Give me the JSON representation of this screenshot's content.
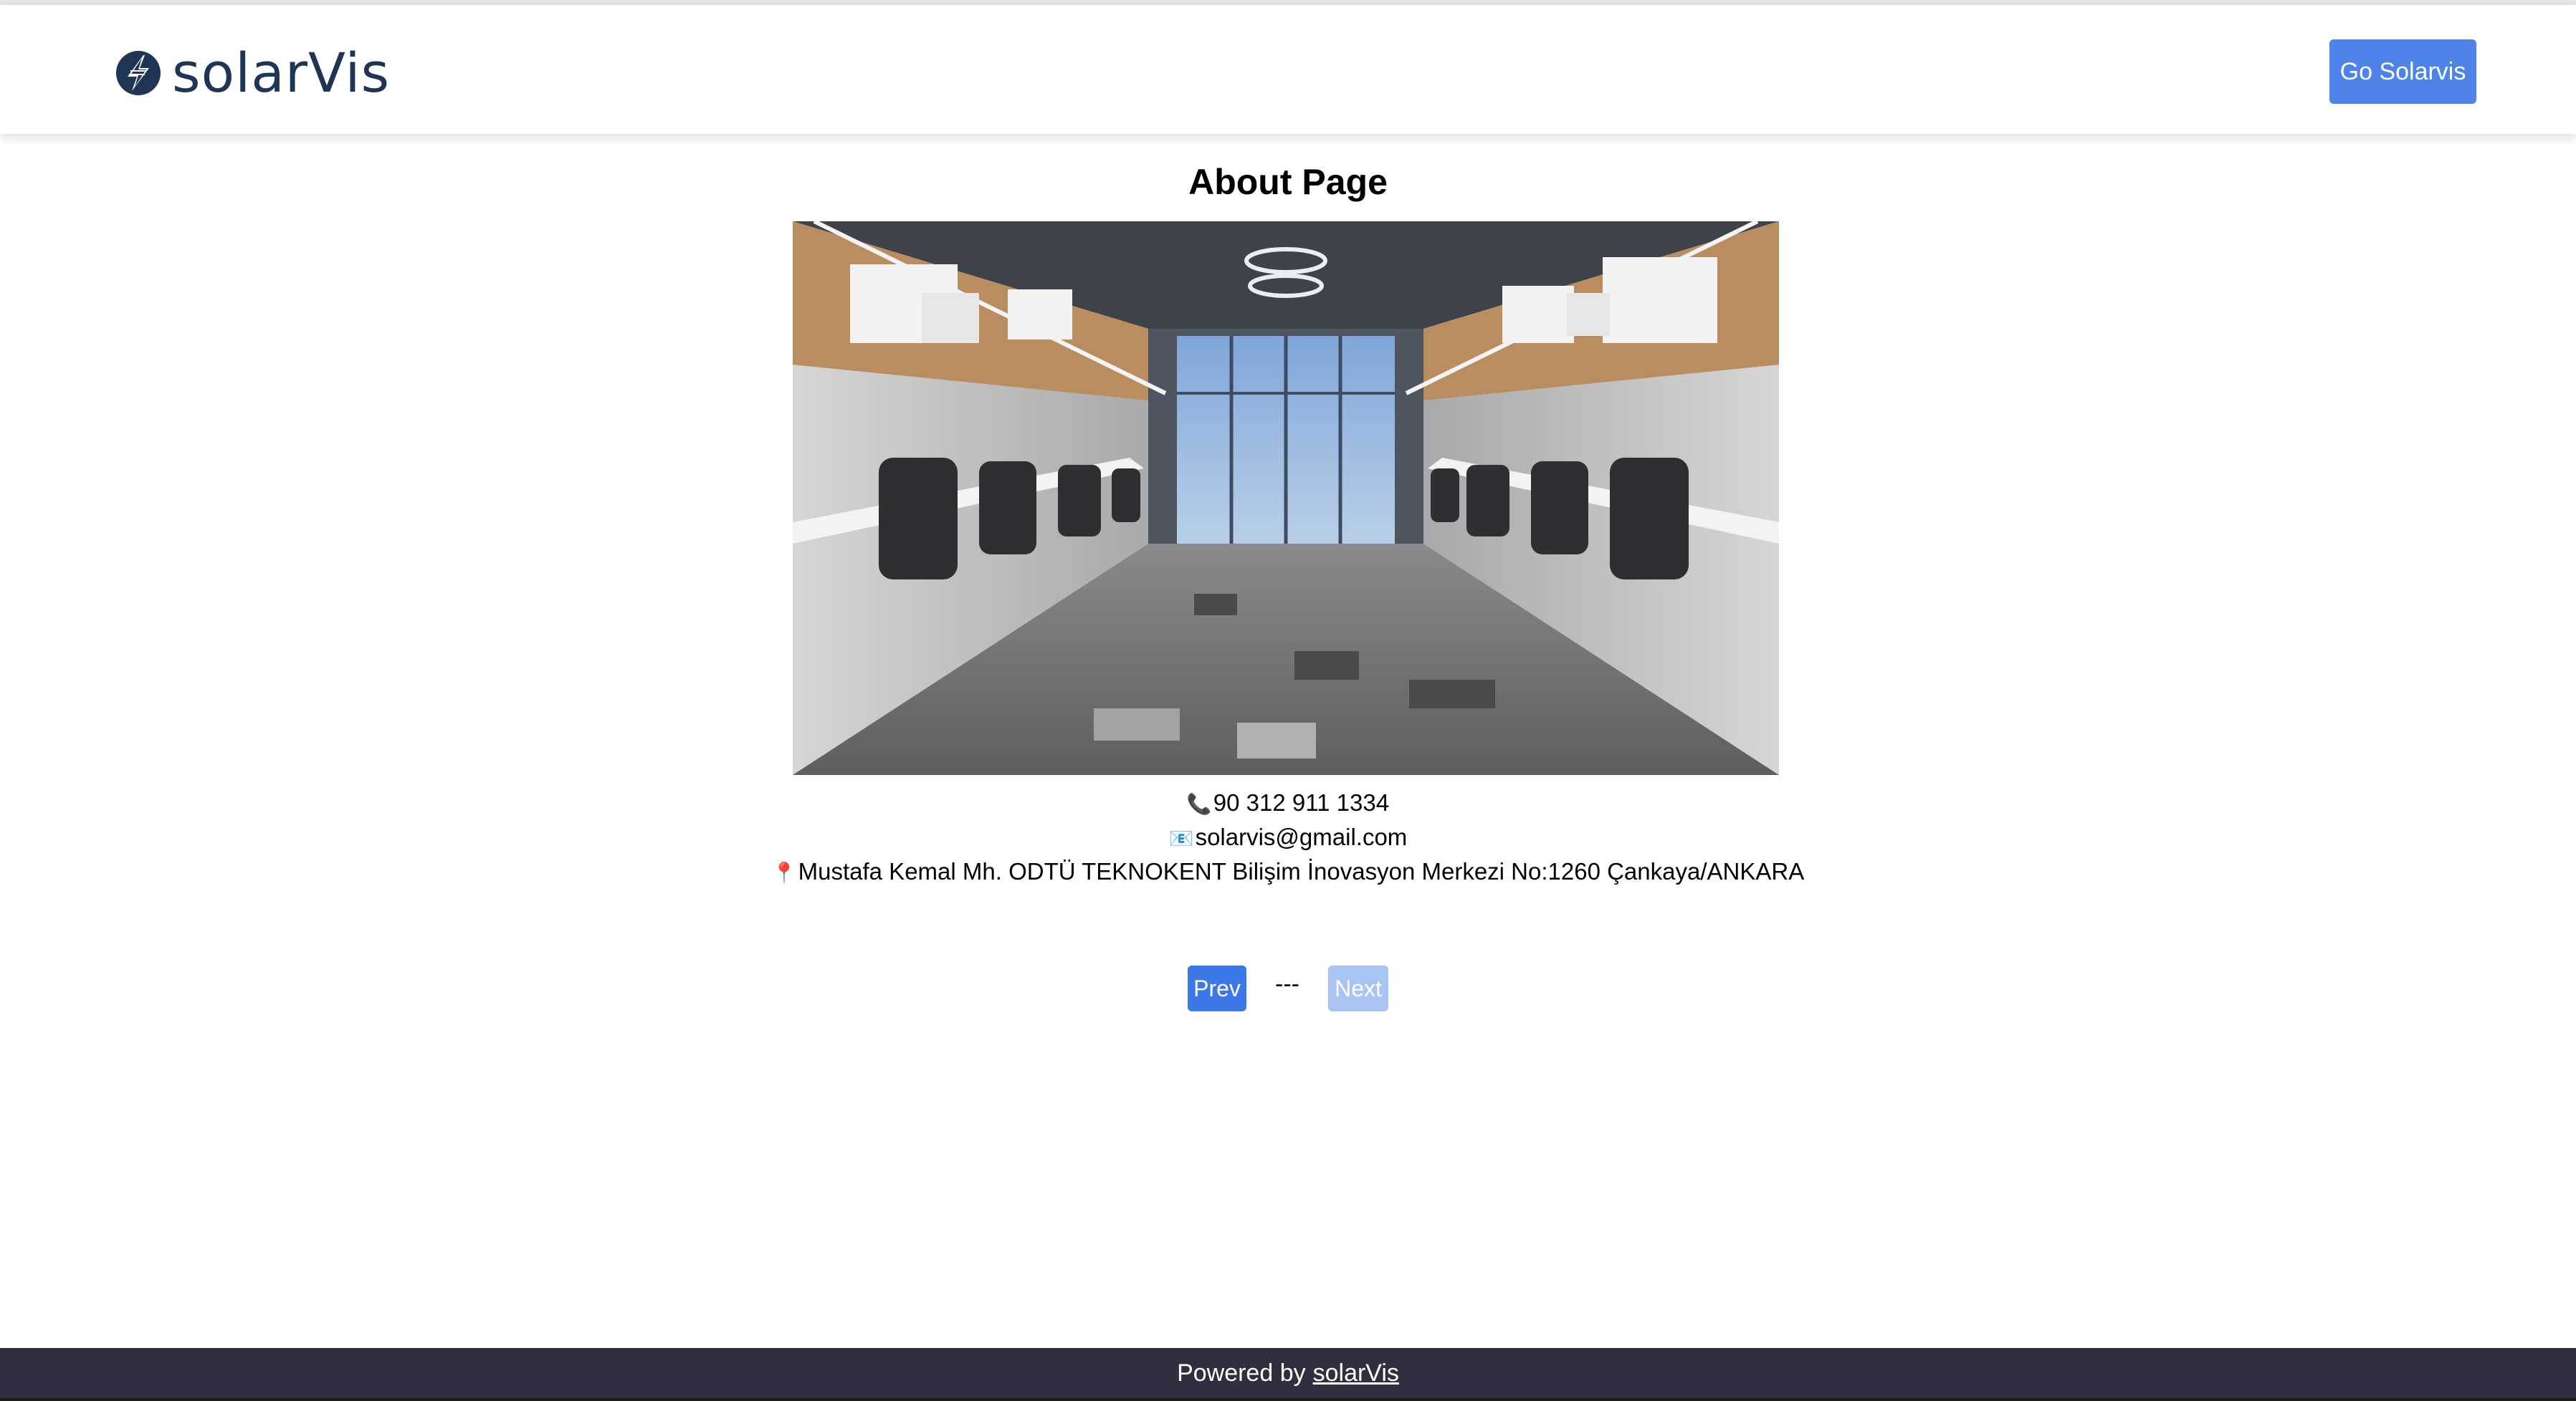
{
  "header": {
    "brand_name": "solarVis",
    "cta_label": "Go Solarvis"
  },
  "main": {
    "title": "About Page",
    "photo_icon": "office-interior-photo",
    "phone": "90 312 911 1334",
    "email": "solarvis@gmail.com",
    "address": "Mustafa Kemal Mh. ODTÜ TEKNOKENT Bilişim İnovasyon Merkezi No:1260 Çankaya/ANKARA"
  },
  "pagination": {
    "prev_label": "Prev",
    "separator": "---",
    "next_label": "Next"
  },
  "footer": {
    "text": "Powered by",
    "link_label": "solarVis"
  },
  "colors": {
    "brand": "#1f3556",
    "primary_button": "#4e84ea",
    "disabled_button": "#a8c4f3",
    "footer_bg": "#2f2f3f"
  }
}
